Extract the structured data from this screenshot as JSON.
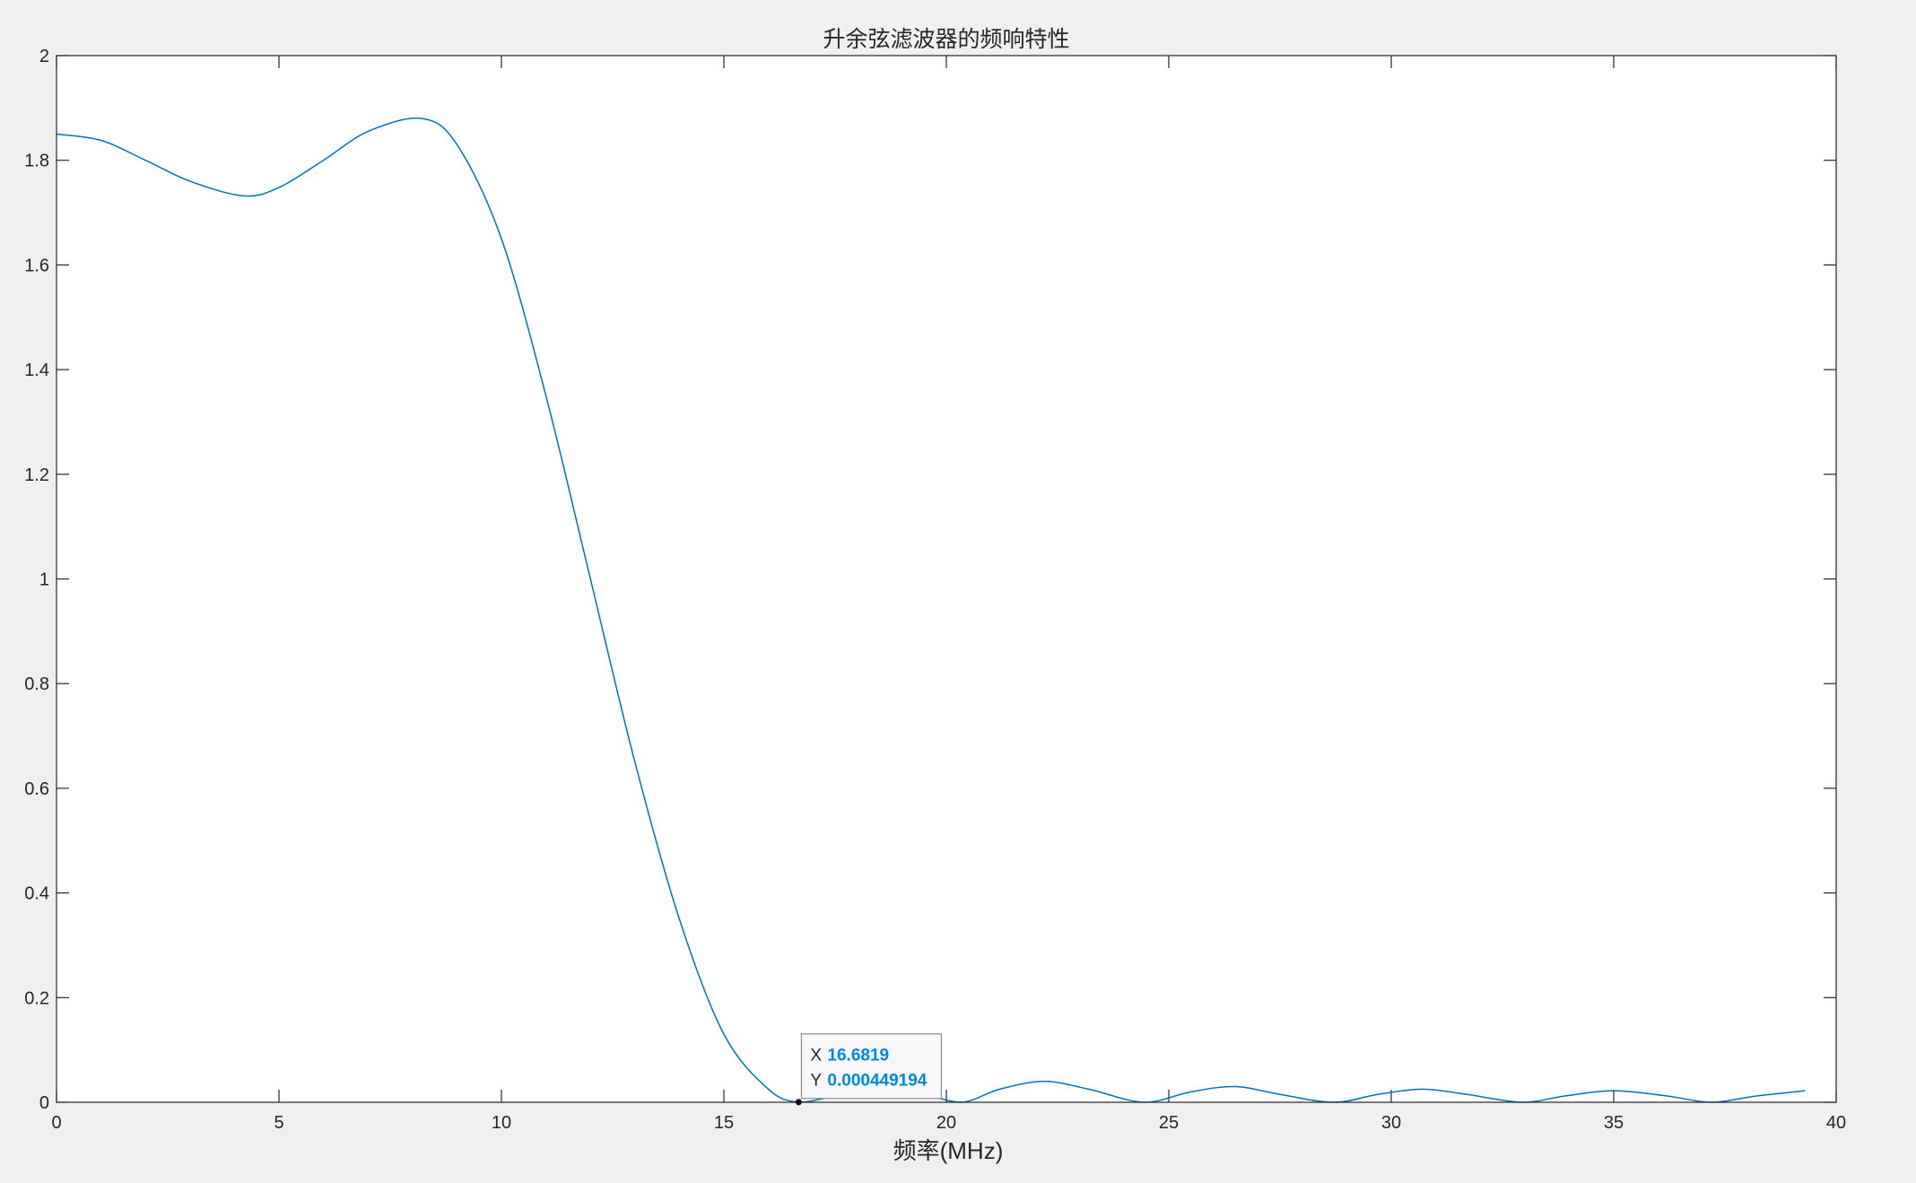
{
  "chart_data": {
    "type": "line",
    "title": "升余弦滤波器的频响特性",
    "xlabel": "频率(MHz)",
    "ylabel": "",
    "xlim": [
      0,
      40
    ],
    "ylim": [
      0,
      2
    ],
    "xticks": [
      0,
      5,
      10,
      15,
      20,
      25,
      30,
      35,
      40
    ],
    "yticks": [
      0,
      0.2,
      0.4,
      0.6,
      0.8,
      1,
      1.2,
      1.4,
      1.6,
      1.8,
      2
    ],
    "xtick_labels": [
      "0",
      "5",
      "10",
      "15",
      "20",
      "25",
      "30",
      "35",
      "40"
    ],
    "ytick_labels": [
      "0",
      "0.2",
      "0.4",
      "0.6",
      "0.8",
      "1",
      "1.2",
      "1.4",
      "1.6",
      "1.8",
      "2"
    ],
    "grid": false,
    "box": true,
    "series": [
      {
        "color": "#0072bd",
        "x": [
          0,
          1,
          2,
          3,
          4.2,
          5,
          6,
          7,
          8.2,
          9,
          10,
          11,
          12,
          13,
          14,
          15,
          16,
          16.68,
          17.5,
          18.5,
          19.5,
          20.35,
          21.2,
          22.2,
          23.2,
          24.45,
          25.5,
          26.5,
          27.5,
          28.7,
          29.7,
          30.7,
          31.7,
          32.95,
          33.9,
          35,
          36.2,
          37.2,
          38.2,
          39.3
        ],
        "y": [
          1.85,
          1.838,
          1.8,
          1.76,
          1.732,
          1.748,
          1.8,
          1.855,
          1.88,
          1.83,
          1.65,
          1.35,
          1.0,
          0.65,
          0.35,
          0.13,
          0.025,
          0.000449194,
          0.012,
          0.03,
          0.015,
          0.0,
          0.025,
          0.04,
          0.025,
          0.0,
          0.02,
          0.03,
          0.015,
          0.0,
          0.015,
          0.025,
          0.015,
          0.0,
          0.012,
          0.022,
          0.012,
          0.0,
          0.012,
          0.022
        ]
      }
    ],
    "datatip": {
      "x_key": "X",
      "x_value": "16.6819",
      "y_key": "Y",
      "y_value": "0.000449194",
      "point_x": 16.6819,
      "point_y": 0.000449194,
      "value_color": "#0088e6"
    }
  }
}
